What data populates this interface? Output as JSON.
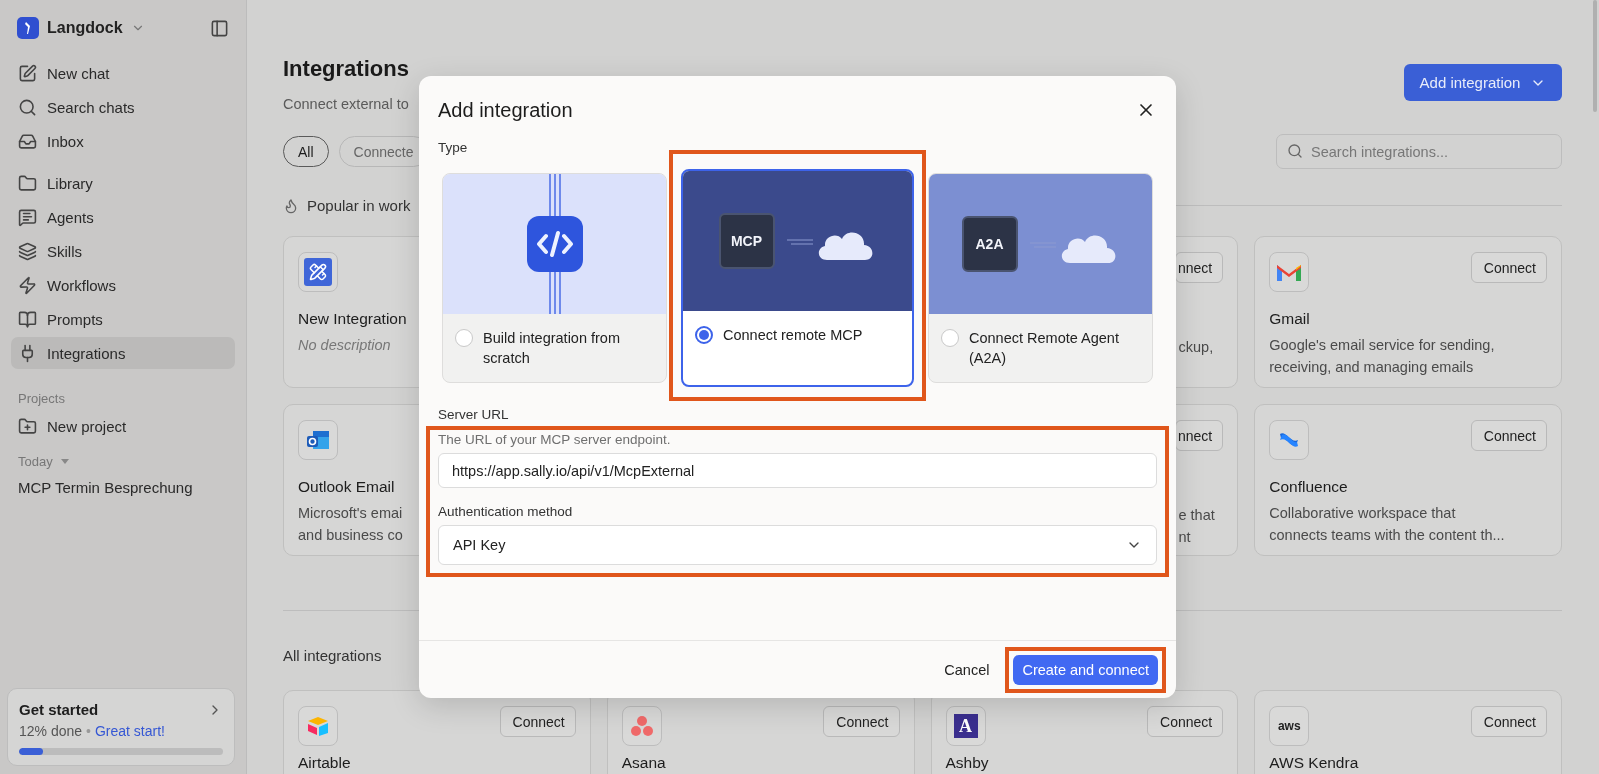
{
  "sidebar": {
    "brand": "Langdock",
    "nav_top": [
      {
        "label": "New chat",
        "selected": false
      },
      {
        "label": "Search chats",
        "selected": false
      },
      {
        "label": "Inbox",
        "selected": false
      }
    ],
    "nav_main": [
      {
        "label": "Library",
        "selected": false
      },
      {
        "label": "Agents",
        "selected": false
      },
      {
        "label": "Skills",
        "selected": false
      },
      {
        "label": "Workflows",
        "selected": false
      },
      {
        "label": "Prompts",
        "selected": false
      },
      {
        "label": "Integrations",
        "selected": true
      }
    ],
    "projects_label": "Projects",
    "new_project": "New project",
    "today_label": "Today",
    "chats": [
      "MCP Termin Besprechung"
    ],
    "get_started": {
      "title": "Get started",
      "progress_text": "12% done",
      "separator": "•",
      "encouragement": "Great start!",
      "level": 0.12
    }
  },
  "page": {
    "title": "Integrations",
    "subtitle": "Connect external to",
    "add_button": "Add integration",
    "filters": [
      {
        "label": "All",
        "selected": true
      },
      {
        "label": "Connecte",
        "selected": false
      }
    ],
    "search": {
      "placeholder": "Search integrations..."
    },
    "popular_heading": "Popular in work",
    "popular_rows": [
      [
        {
          "kind": "custom",
          "title": "New Integration",
          "description_lines": [
            "No description"
          ],
          "description_missing": true
        },
        {
          "kind": "partial",
          "connect": "nnect",
          "description_lines": [
            "ckup,"
          ]
        },
        {
          "kind": "gmail",
          "connect": "Connect",
          "title": "Gmail",
          "description_lines": [
            "Google's email service for sending,",
            "receiving, and managing emails"
          ],
          "description_missing": false
        }
      ],
      [
        {
          "kind": "outlook",
          "title": "Outlook Email",
          "description_lines": [
            "Microsoft's emai",
            "and business co"
          ],
          "description_missing": false
        },
        {
          "kind": "partial",
          "connect": "nnect",
          "description_lines": [
            "e that",
            "nt"
          ]
        },
        {
          "kind": "confluence",
          "connect": "Connect",
          "title": "Confluence",
          "description_lines": [
            "Collaborative workspace that",
            "connects teams with the content th..."
          ],
          "description_missing": false
        }
      ]
    ],
    "all_heading": "All integrations",
    "all_cards": [
      {
        "kind": "airtable",
        "connect": "Connect",
        "title": "Airtable"
      },
      {
        "kind": "asana",
        "connect": "Connect",
        "title": "Asana"
      },
      {
        "kind": "ashby",
        "logo_text": "A",
        "connect": "Connect",
        "title": "Ashby"
      },
      {
        "kind": "aws",
        "logo_text": "aws",
        "connect": "Connect",
        "title": "AWS Kendra"
      }
    ]
  },
  "modal": {
    "title": "Add integration",
    "type_label": "Type",
    "types": [
      {
        "kind": "code",
        "label": "Build integration from scratch",
        "selected": false,
        "highlighted": false
      },
      {
        "kind": "mcp",
        "chip": "MCP",
        "label": "Connect remote MCP",
        "selected": true,
        "highlighted": true
      },
      {
        "kind": "a2a",
        "chip": "A2A",
        "label": "Connect Remote Agent (A2A)",
        "selected": false,
        "highlighted": false
      }
    ],
    "server_url": {
      "label": "Server URL",
      "hint": "The URL of your MCP server endpoint.",
      "value": "https://app.sally.io/api/v1/McpExternal"
    },
    "auth": {
      "label": "Authentication method",
      "value": "API Key"
    },
    "fields_highlighted": true,
    "cancel": "Cancel",
    "submit": {
      "label": "Create and connect",
      "highlighted": true
    }
  }
}
